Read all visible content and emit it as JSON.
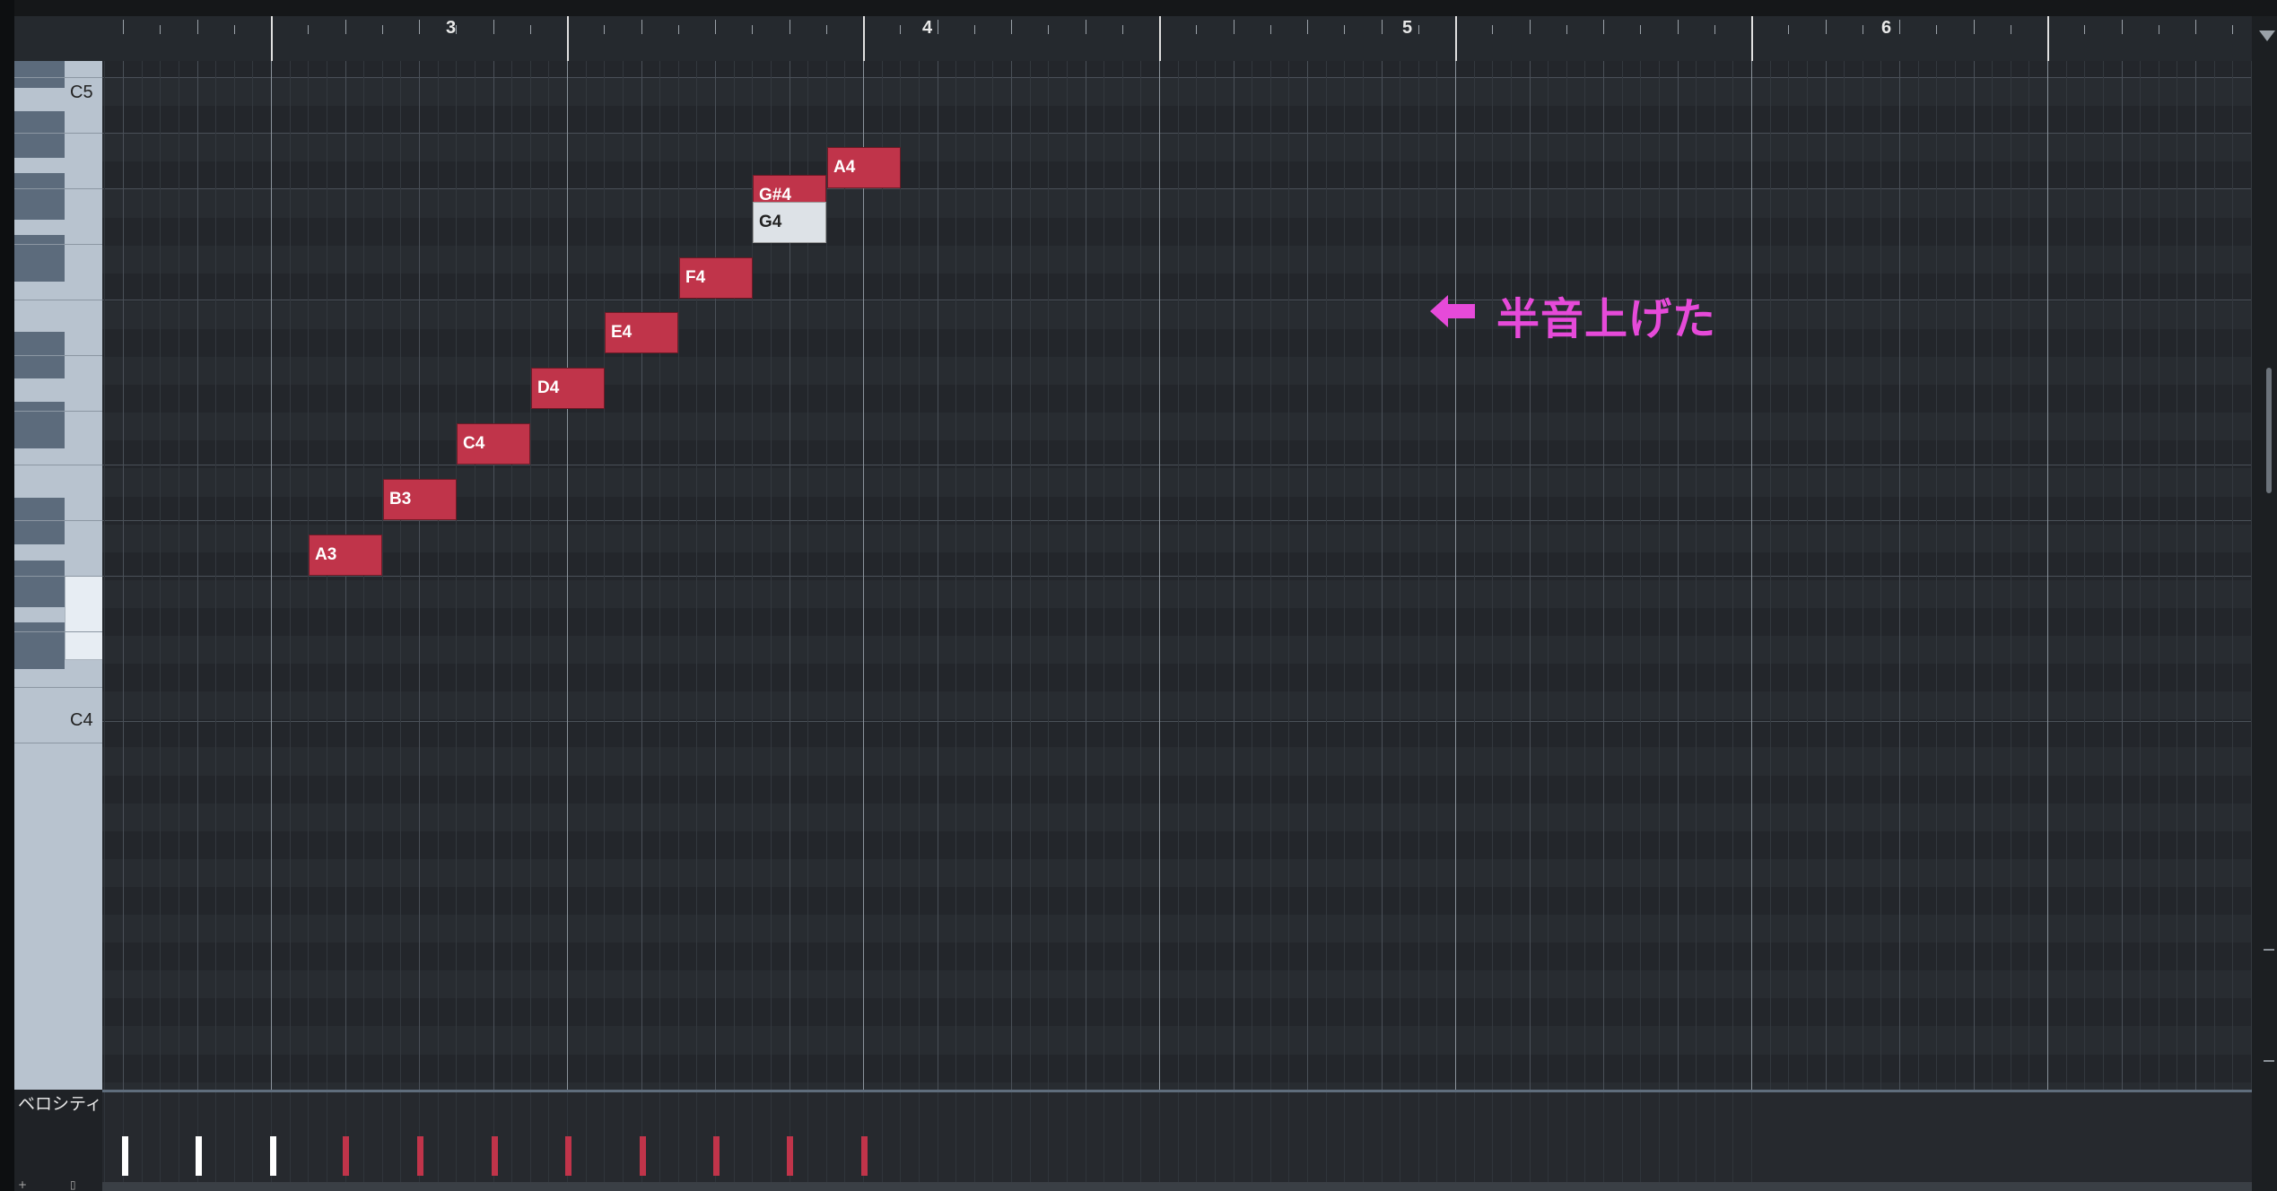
{
  "ruler": {
    "bars": [
      "3",
      "4",
      "5",
      "6"
    ]
  },
  "keyboard": {
    "labels": [
      "C5",
      "C4"
    ]
  },
  "notes": [
    {
      "label": "A3",
      "state": "normal"
    },
    {
      "label": "B3",
      "state": "normal"
    },
    {
      "label": "C4",
      "state": "normal"
    },
    {
      "label": "D4",
      "state": "normal"
    },
    {
      "label": "E4",
      "state": "normal"
    },
    {
      "label": "F4",
      "state": "normal"
    },
    {
      "label": "G#4",
      "state": "normal"
    },
    {
      "label": "G4",
      "state": "ghost"
    },
    {
      "label": "A4",
      "state": "normal"
    }
  ],
  "annotation": {
    "text": "半音上げた",
    "arrow_icon": "left-arrow-icon"
  },
  "velocity": {
    "label": "ベロシティ",
    "bars": [
      {
        "color": "#ffffff"
      },
      {
        "color": "#ffffff"
      },
      {
        "color": "#ffffff"
      },
      {
        "color": "#c0344a"
      },
      {
        "color": "#c0344a"
      },
      {
        "color": "#c0344a"
      },
      {
        "color": "#c0344a"
      },
      {
        "color": "#c0344a"
      },
      {
        "color": "#c0344a"
      },
      {
        "color": "#c0344a"
      },
      {
        "color": "#c0344a"
      }
    ]
  },
  "colors": {
    "note_fill": "#c0344a",
    "ghost_fill": "#dde2e7",
    "annotation": "#e64ad9",
    "grid_bg": "#282c31"
  }
}
